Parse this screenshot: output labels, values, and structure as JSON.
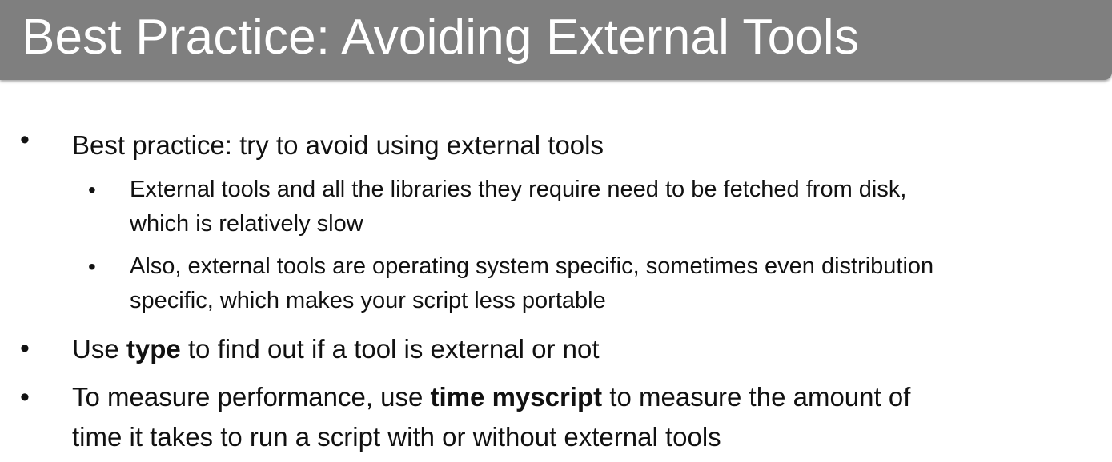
{
  "slide": {
    "title": "Best Practice: Avoiding External Tools"
  },
  "bullets": [
    {
      "level": 1,
      "text": "Best practice: try to avoid using external tools"
    },
    {
      "level": 2,
      "line1": "External tools and all the libraries they require need to be fetched from disk,",
      "line2": "which is relatively slow"
    },
    {
      "level": 2,
      "line1": "Also, external tools are operating system specific, sometimes even distribution",
      "line2": "specific, which makes your script less portable"
    },
    {
      "level": 1,
      "before": "Use ",
      "bold": "type",
      "after": " to find out if a tool is external or not"
    },
    {
      "level": 1,
      "before": "To measure performance, use ",
      "bold": "time myscript",
      "after": " to measure the amount of",
      "line2": "time it takes to run a script with or without external tools"
    }
  ],
  "bullet_symbol": "•"
}
